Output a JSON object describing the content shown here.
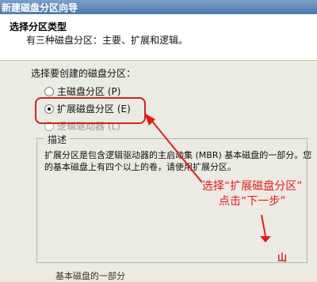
{
  "window": {
    "title": "新建磁盘分区向导"
  },
  "header": {
    "title": "选择分区类型",
    "subtitle": "有三种磁盘分区：主要、扩展和逻辑。"
  },
  "main": {
    "prompt": "选择要创建的磁盘分区：",
    "options": [
      {
        "label": "主磁盘分区 (P)",
        "selected": false,
        "enabled": true
      },
      {
        "label": "扩展磁盘分区 (E)",
        "selected": true,
        "enabled": true
      },
      {
        "label": "逻辑驱动器 (L)",
        "selected": false,
        "enabled": false
      }
    ],
    "description_label": "描述",
    "description_text": "扩展分区是包含逻辑驱动器的主启动集 (MBR) 基本磁盘的一部分。您的基本磁盘上有四个以上的卷，请使用扩展分区。"
  },
  "annotation": {
    "line1": "选择“扩展磁盘分区”",
    "line2": "点击“下一步”",
    "color": "#e31b1b"
  },
  "partial": {
    "bottom_text": "基本磁盘的一部分",
    "stub_glyph": "山"
  }
}
